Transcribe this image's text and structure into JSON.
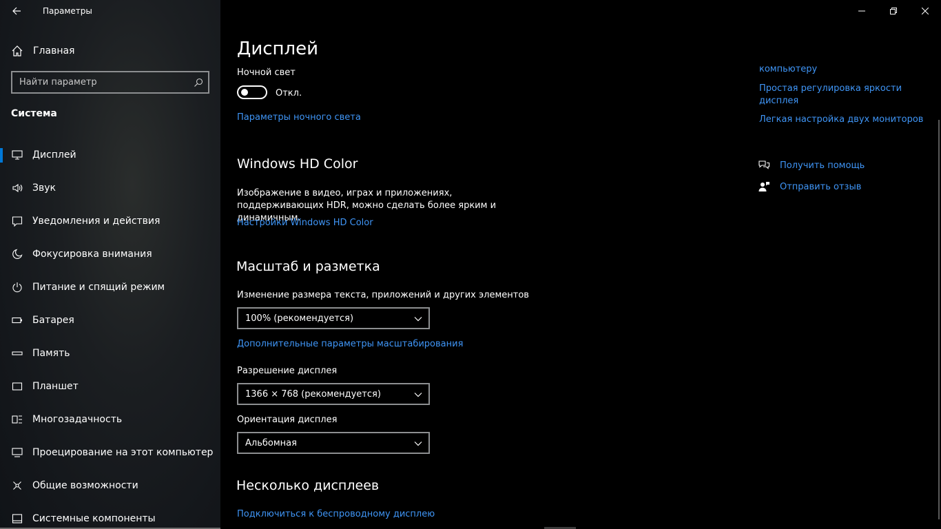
{
  "window": {
    "title": "Параметры",
    "controls": [
      "minimize-icon",
      "restore-icon",
      "close-icon"
    ]
  },
  "sidebar": {
    "home_label": "Главная",
    "search_placeholder": "Найти параметр",
    "section_title": "Система",
    "items": [
      {
        "label": "Дисплей",
        "icon": "monitor-icon",
        "selected": true
      },
      {
        "label": "Звук",
        "icon": "speaker-icon"
      },
      {
        "label": "Уведомления и действия",
        "icon": "notification-icon"
      },
      {
        "label": "Фокусировка внимания",
        "icon": "moon-icon"
      },
      {
        "label": "Питание и спящий режим",
        "icon": "power-icon"
      },
      {
        "label": "Батарея",
        "icon": "battery-icon"
      },
      {
        "label": "Память",
        "icon": "storage-icon"
      },
      {
        "label": "Планшет",
        "icon": "tablet-icon"
      },
      {
        "label": "Многозадачность",
        "icon": "multitasking-icon"
      },
      {
        "label": "Проецирование на этот компьютер",
        "icon": "projection-icon"
      },
      {
        "label": "Общие возможности",
        "icon": "shared-experiences-icon"
      },
      {
        "label": "Системные компоненты",
        "icon": "components-icon"
      }
    ]
  },
  "main": {
    "page_title": "Дисплей",
    "night_light": {
      "label": "Ночной свет",
      "state_label": "Откл.",
      "on": false,
      "settings_link": "Параметры ночного света"
    },
    "hd_color": {
      "heading": "Windows HD Color",
      "description": "Изображение в видео, играх и приложениях, поддерживающих HDR, можно сделать более ярким и динамичным.",
      "link": "Настройки Windows HD Color"
    },
    "scale": {
      "heading": "Масштаб и разметка",
      "size_label": "Изменение размера текста, приложений и других элементов",
      "size_value": "100% (рекомендуется)",
      "advanced_link": "Дополнительные параметры масштабирования",
      "resolution_label": "Разрешение дисплея",
      "resolution_value": "1366 × 768 (рекомендуется)",
      "orientation_label": "Ориентация дисплея",
      "orientation_value": "Альбомная"
    },
    "multiple": {
      "heading": "Несколько дисплеев",
      "wireless_link": "Подключиться к беспроводному дисплею"
    }
  },
  "right": {
    "links": [
      "компьютеру",
      "Простая регулировка яркости дисплея",
      "Легкая настройка двух мониторов"
    ],
    "help": "Получить помощь",
    "feedback": "Отправить отзыв"
  },
  "colors": {
    "accent": "#0078d7",
    "link": "#3f95f6",
    "background": "#000000"
  }
}
